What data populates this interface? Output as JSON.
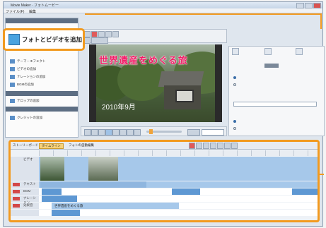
{
  "window": {
    "title": "Movie Maker · フォトムービー",
    "menu": [
      "ファイル(F)",
      "編集"
    ]
  },
  "left_panel": {
    "add_photo_label": "フォトとビデオを追加",
    "items": [
      {
        "label": "テーマ・エフェクト"
      },
      {
        "label": "ビデオの追加"
      },
      {
        "label": "ナレーションの追加"
      },
      {
        "label": "BGMの追加"
      },
      {
        "label": "テロップの追加"
      },
      {
        "label": "クレジットの追加"
      }
    ]
  },
  "preview": {
    "title_overlay": "世界遺産をめぐる旅",
    "date_overlay": "2010年9月"
  },
  "timeline": {
    "tabs": [
      "ストーリーボード",
      "タイムライン",
      "フォトの自動編集"
    ],
    "tracks": [
      {
        "name": "ビデオ"
      },
      {
        "name": "テキスト"
      },
      {
        "name": "BGM"
      },
      {
        "name": "ナレーション"
      },
      {
        "name": "効果音"
      }
    ],
    "clip_labels": [
      "世界遺産をめぐる旅"
    ]
  },
  "colors": {
    "highlight": "#f29a1f",
    "title_text": "#f31b67",
    "track_blue": "#5e98d3",
    "track_light": "#a6c8ea"
  }
}
